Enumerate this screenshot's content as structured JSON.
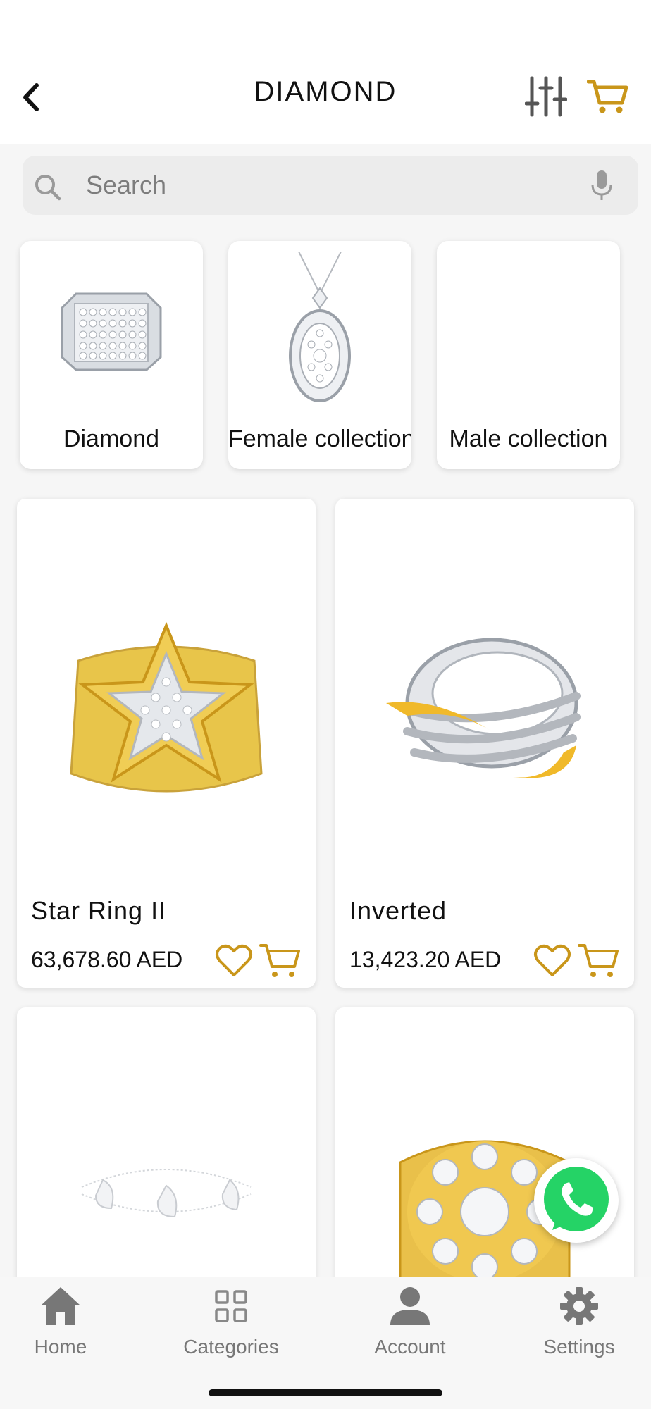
{
  "header": {
    "title": "DIAMOND",
    "back_icon": "chevron-left-icon",
    "filter_icon": "sliders-icon",
    "cart_icon": "cart-icon",
    "accent_color": "#c9961a"
  },
  "search": {
    "placeholder": "Search",
    "value": "",
    "icon": "search-icon",
    "mic_icon": "microphone-icon"
  },
  "categories": [
    {
      "label": "Diamond"
    },
    {
      "label": "Female collection"
    },
    {
      "label": "Male collection"
    }
  ],
  "products": [
    {
      "name": "Star Ring II",
      "price": "63,678.60 AED"
    },
    {
      "name": "Inverted",
      "price": "13,423.20 AED"
    },
    {
      "name": "",
      "price": ""
    },
    {
      "name": "",
      "price": ""
    }
  ],
  "floating": {
    "icon": "whatsapp-icon",
    "color": "#25d366"
  },
  "bottom_nav": {
    "items": [
      {
        "label": "Home",
        "icon": "home-icon"
      },
      {
        "label": "Categories",
        "icon": "grid-icon"
      },
      {
        "label": "Account",
        "icon": "user-icon"
      },
      {
        "label": "Settings",
        "icon": "gear-icon"
      }
    ]
  }
}
